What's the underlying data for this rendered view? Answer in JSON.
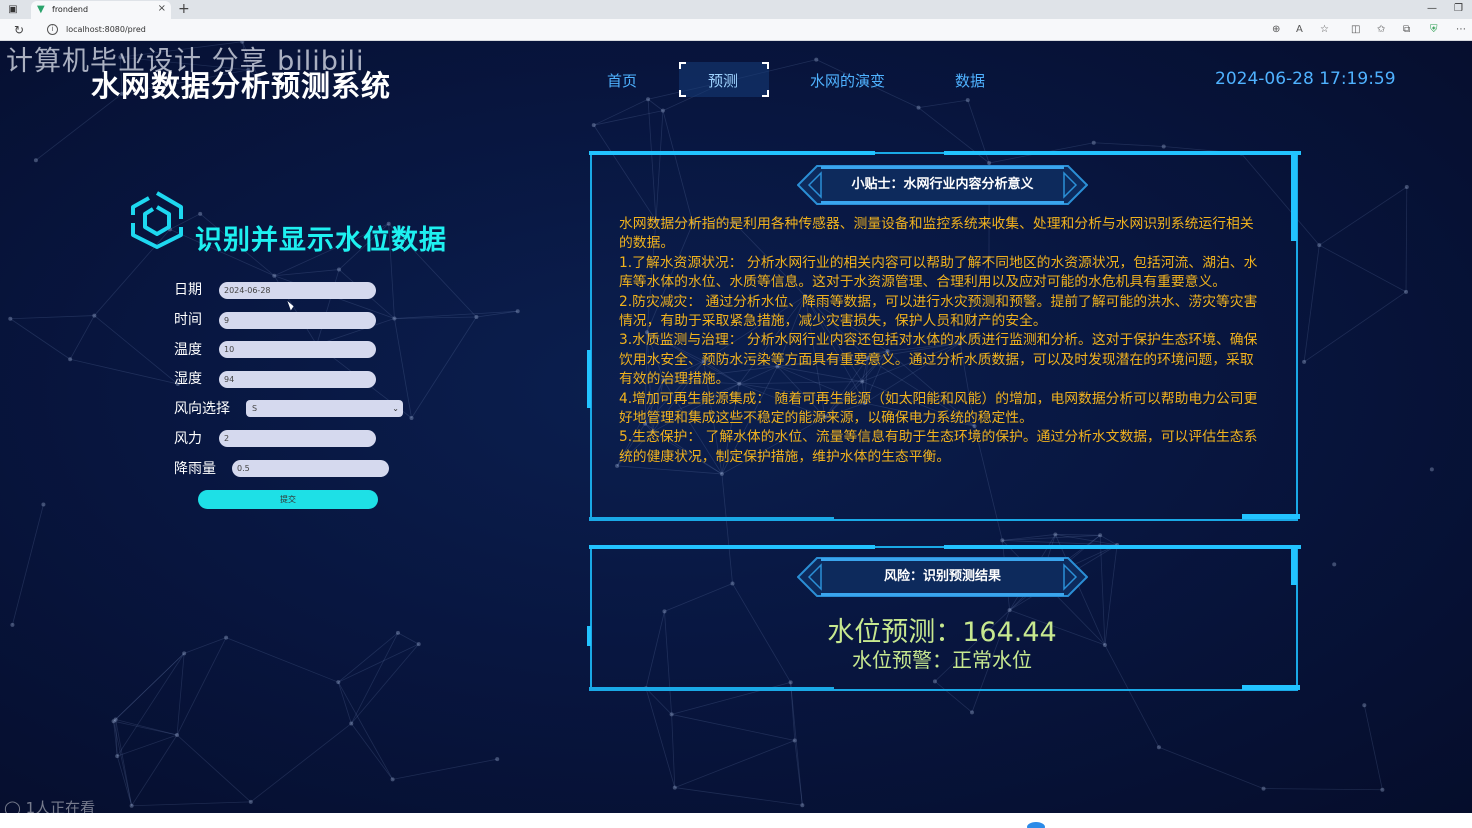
{
  "browser": {
    "tab_title": "frondend",
    "url": "localhost:8080/pred",
    "new_tab_label": "+",
    "close_label": "×"
  },
  "watermark": "计算机毕业设计 分享 bilibili",
  "app_title": "水网数据分析预测系统",
  "nav": {
    "items": [
      "首页",
      "预测",
      "水网的演变",
      "数据"
    ],
    "active": "预测"
  },
  "datetime": "2024-06-28 17:19:59",
  "form": {
    "title": "识别并显示水位数据",
    "fields": {
      "date": {
        "label": "日期",
        "value": "2024-06-28"
      },
      "time": {
        "label": "时间",
        "value": "9"
      },
      "temperature": {
        "label": "温度",
        "value": "10"
      },
      "humidity": {
        "label": "湿度",
        "value": "94"
      },
      "wind_direction": {
        "label": "风向选择",
        "value": "S"
      },
      "wind_force": {
        "label": "风力",
        "value": "2"
      },
      "rainfall": {
        "label": "降雨量",
        "value": "0.5"
      }
    },
    "submit_label": "提交"
  },
  "tips": {
    "title": "小贴士：水网行业内容分析意义",
    "paragraphs": [
      "水网数据分析指的是利用各种传感器、测量设备和监控系统来收集、处理和分析与水网识别系统运行相关的数据。",
      "1.了解水资源状况： 分析水网行业的相关内容可以帮助了解不同地区的水资源状况，包括河流、湖泊、水库等水体的水位、水质等信息。这对于水资源管理、合理利用以及应对可能的水危机具有重要意义。",
      "2.防灾减灾： 通过分析水位、降雨等数据，可以进行水灾预测和预警。提前了解可能的洪水、涝灾等灾害情况，有助于采取紧急措施，减少灾害损失，保护人员和财产的安全。",
      "3.水质监测与治理： 分析水网行业内容还包括对水体的水质进行监测和分析。这对于保护生态环境、确保饮用水安全、预防水污染等方面具有重要意义。通过分析水质数据，可以及时发现潜在的环境问题，采取有效的治理措施。",
      "4.增加可再生能源集成： 随着可再生能源（如太阳能和风能）的增加，电网数据分析可以帮助电力公司更好地管理和集成这些不稳定的能源来源，以确保电力系统的稳定性。",
      "5.生态保护： 了解水体的水位、流量等信息有助于生态环境的保护。通过分析水文数据，可以评估生态系统的健康状况，制定保护措施，维护水体的生态平衡。"
    ]
  },
  "risk": {
    "title": "风险：识别预测结果",
    "prediction_label": "水位预测：",
    "prediction_value": "164.44",
    "warning_label": "水位预警：",
    "warning_value": "正常水位"
  },
  "viewers": "1人正在看",
  "colors": {
    "accent_cyan": "#1ef0f0",
    "nav_blue": "#4fb2ff",
    "panel_border": "#1aa9e6",
    "tips_text": "#f0b21e",
    "result_text": "#c7e88f",
    "page_bg": "#071233"
  }
}
